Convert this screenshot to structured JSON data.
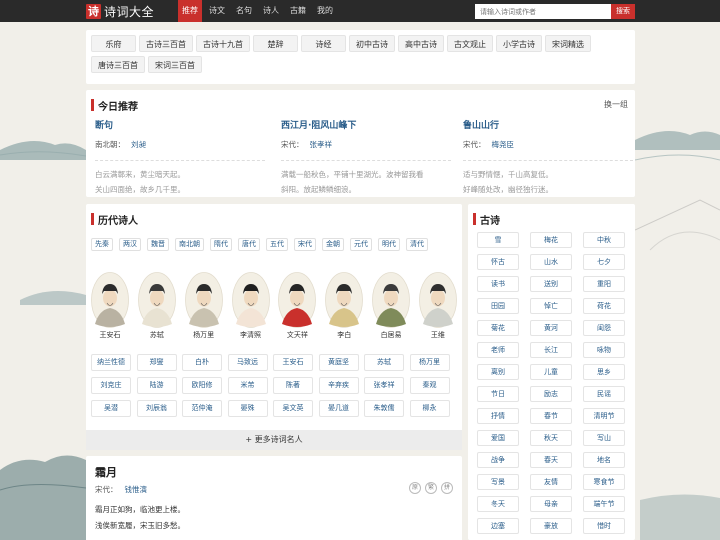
{
  "header": {
    "logo_mark": "诗",
    "logo_text": "诗词大全",
    "nav": [
      "推荐",
      "诗文",
      "名句",
      "诗人",
      "古籍",
      "我的"
    ],
    "search_placeholder": "请输入诗词或作者",
    "search_button": "搜索"
  },
  "categories": [
    "乐府",
    "古诗三百首",
    "古诗十九首",
    "楚辞",
    "诗经",
    "初中古诗",
    "高中古诗",
    "古文观止",
    "小学古诗",
    "宋词精选",
    "唐诗三百首",
    "宋词三百首"
  ],
  "today": {
    "title": "今日推荐",
    "refresh": "换一组",
    "poems": [
      {
        "title": "断句",
        "dynasty": "南北朝：",
        "author": "刘昶",
        "lines": [
          "白云满鄣来，黄尘暗天起。",
          "关山四面绝，故乡几千里。"
        ]
      },
      {
        "title": "西江月·阻风山峰下",
        "dynasty": "宋代：",
        "author": "张孝祥",
        "lines": [
          "满载一船秋色，平铺十里湖光。波神留我看",
          "斜阳。放起鳞鳞细浪。"
        ]
      },
      {
        "title": "鲁山山行",
        "dynasty": "宋代：",
        "author": "梅尧臣",
        "lines": [
          "适与野情惬，千山高复低。",
          "好峰随处改，幽径独行迷。"
        ]
      }
    ]
  },
  "poets": {
    "title": "历代诗人",
    "eras": [
      "先秦",
      "两汉",
      "魏晋",
      "南北朝",
      "隋代",
      "唐代",
      "五代",
      "宋代",
      "金朝",
      "元代",
      "明代",
      "清代"
    ],
    "featured": [
      "王安石",
      "苏轼",
      "杨万里",
      "李清照",
      "文天祥",
      "李白",
      "白居易",
      "王维"
    ],
    "names": [
      "纳兰性德",
      "郑燮",
      "白朴",
      "马致远",
      "王安石",
      "黄庭坚",
      "苏轼",
      "杨万里",
      "刘克庄",
      "陆游",
      "欧阳修",
      "米芾",
      "陈著",
      "辛弃疾",
      "张孝祥",
      "秦观",
      "吴潜",
      "刘辰翁",
      "范仲淹",
      "晏殊",
      "吴文英",
      "晏几道",
      "朱敦儒",
      "柳永"
    ],
    "more": "+ 更多诗词名人"
  },
  "poem": {
    "title": "霜月",
    "dynasty": "宋代：",
    "author": "钱惟演",
    "icons": [
      "原",
      "繁",
      "拼"
    ],
    "lines": [
      "霜月正如狗，临池更上楼。",
      "浅俟新宽履，宋玉旧多愁。"
    ]
  },
  "tags": {
    "title": "古诗",
    "items": [
      "雪",
      "梅花",
      "中秋",
      "怀古",
      "山水",
      "七夕",
      "读书",
      "送别",
      "重阳",
      "田园",
      "悼亡",
      "荷花",
      "菊花",
      "黄河",
      "闺怨",
      "老师",
      "长江",
      "咏物",
      "离别",
      "儿童",
      "思乡",
      "节日",
      "励志",
      "民谣",
      "抒情",
      "春节",
      "清明节",
      "爱国",
      "秋天",
      "写山",
      "战争",
      "春天",
      "地名",
      "写景",
      "友情",
      "寒食节",
      "冬天",
      "母亲",
      "端午节",
      "边塞",
      "豪放",
      "惜时",
      "写风",
      "爱情",
      "婉约"
    ]
  },
  "colors": {
    "accent": "#c9302c",
    "link": "#2a5d8a",
    "topbar": "#2a2a2a",
    "background": "#f1efe9"
  }
}
